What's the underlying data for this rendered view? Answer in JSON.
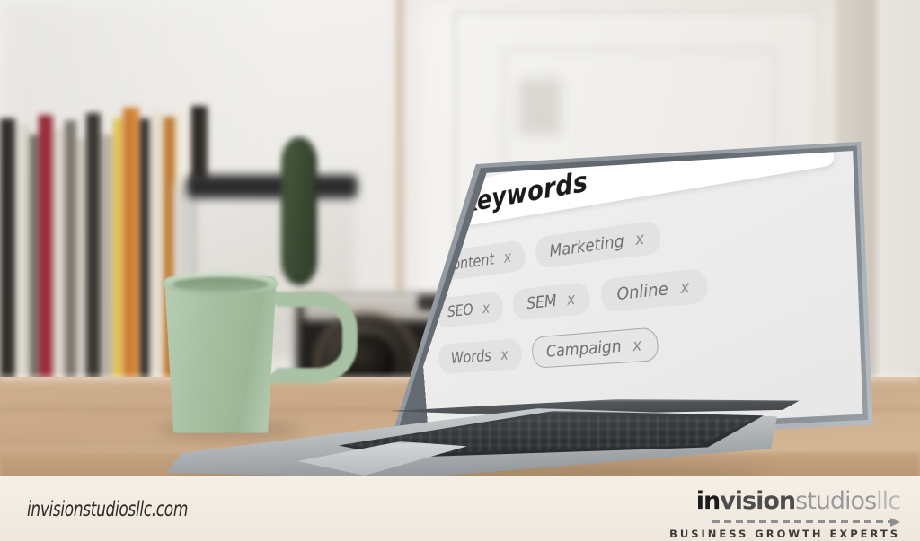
{
  "scene": {
    "description": "Desk photo with laptop showing a keyword tag search interface",
    "desk_color": "#c9a887",
    "wall_color": "#eceae6",
    "mug_color": "#a6bfa1",
    "cactus_color": "#33412c"
  },
  "laptop_screen": {
    "search": {
      "hash_symbol": "#",
      "query_text": "Keywords",
      "search_icon": "magnifier-icon",
      "background": "#ffffff"
    },
    "screen_background": "#ececec",
    "tags": [
      {
        "label": "Content",
        "remove": "x",
        "style": "filled"
      },
      {
        "label": "Marketing",
        "remove": "x",
        "style": "filled"
      },
      {
        "label": "SEO",
        "remove": "x",
        "style": "filled"
      },
      {
        "label": "SEM",
        "remove": "x",
        "style": "filled"
      },
      {
        "label": "Online",
        "remove": "x",
        "style": "filled"
      },
      {
        "label": "Words",
        "remove": "x",
        "style": "filled"
      },
      {
        "label": "Campaign",
        "remove": "x",
        "style": "outlined"
      }
    ],
    "tag_fill_color": "#e2e2e2",
    "tag_text_color": "#6e6e6e"
  },
  "footer": {
    "background": "#f3ece3",
    "website_url": "invisionstudiosllc.com",
    "logo": {
      "part_in": "in",
      "part_vision": "vision",
      "part_studios": "studios",
      "part_llc": "llc",
      "tagline": "BUSINESS GROWTH EXPERTS"
    }
  }
}
